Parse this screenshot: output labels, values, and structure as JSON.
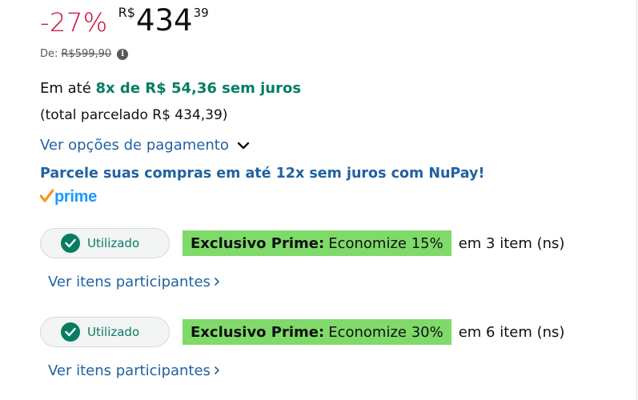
{
  "price": {
    "discount": "-27%",
    "currency": "R$",
    "whole": "434",
    "cents": "39",
    "list_label": "De:",
    "list_price": "R$599,90",
    "info_icon_glyph": "i"
  },
  "installment": {
    "prefix": "Em até",
    "highlight": "8x de R$ 54,36 sem juros",
    "total": "(total parcelado R$ 434,39)"
  },
  "payment_options_link": "Ver opções de pagamento",
  "nupay_banner": "Parcele suas compras em até 12x sem juros com NuPay!",
  "prime_logo": {
    "word": "prime",
    "check_color": "#f7931e",
    "word_color": "#1a98ff"
  },
  "coupons": [
    {
      "status": "Utilizado",
      "promo_bold": "Exclusivo Prime:",
      "promo_text": "Economize 15%",
      "items_text": "em 3 item (ns)",
      "link": "Ver itens participantes"
    },
    {
      "status": "Utilizado",
      "promo_bold": "Exclusivo Prime:",
      "promo_text": "Economize 30%",
      "items_text": "em 6 item (ns)",
      "link": "Ver itens participantes"
    }
  ],
  "colors": {
    "discount_red": "#cc0c39",
    "link_blue": "#2162a1",
    "deal_green": "#067d62",
    "promo_highlight": "#7fda69"
  }
}
